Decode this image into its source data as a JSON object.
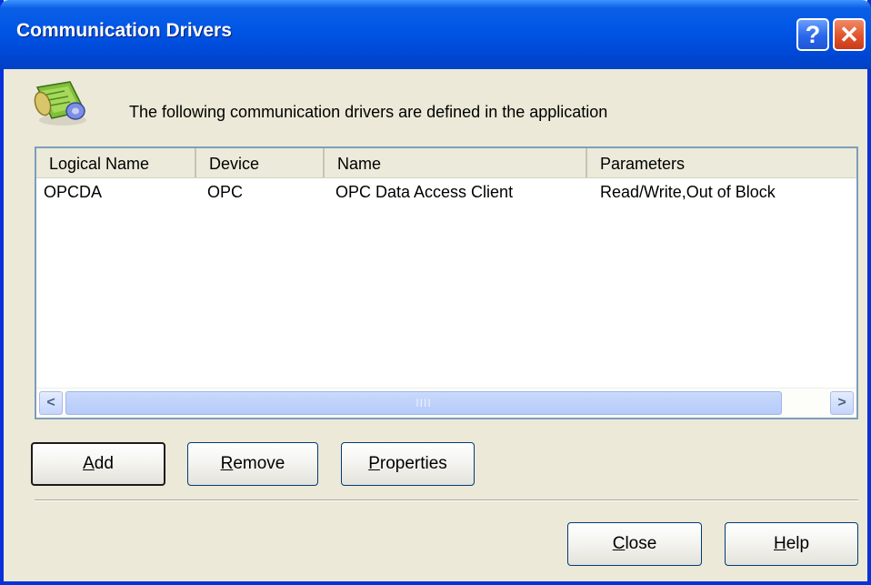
{
  "window": {
    "title": "Communication Drivers",
    "help_glyph": "?",
    "close_glyph": "✕"
  },
  "description": "The following communication drivers are defined in the application",
  "icons": {
    "app": "driver-scroll-icon"
  },
  "table": {
    "columns": [
      "Logical Name",
      "Device",
      "Name",
      "Parameters"
    ],
    "rows": [
      [
        "OPCDA",
        "OPC",
        "OPC Data Access Client",
        "Read/Write,Out of Block"
      ]
    ]
  },
  "scrollbar": {
    "left_arrow": "<",
    "right_arrow": ">",
    "thumb_grip": "IIII"
  },
  "buttons": {
    "add": {
      "accel": "A",
      "rest": "dd"
    },
    "remove": {
      "accel": "R",
      "rest": "emove"
    },
    "properties": {
      "accel": "P",
      "rest": "roperties"
    },
    "close": {
      "accel": "C",
      "rest": "lose"
    },
    "help": {
      "accel": "H",
      "rest": "elp"
    }
  },
  "colors": {
    "title_bar": "#0055e5",
    "dialog_bg": "#ece9d8",
    "list_border": "#7f9db9"
  }
}
